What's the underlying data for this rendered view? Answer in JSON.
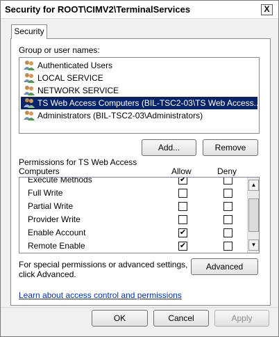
{
  "window": {
    "title": "Security for ROOT\\CIMV2\\TerminalServices",
    "close_label": "X"
  },
  "tabs": [
    {
      "label": "Security"
    }
  ],
  "groups": {
    "label": "Group or user names:",
    "items": [
      {
        "label": "Authenticated Users"
      },
      {
        "label": "LOCAL SERVICE"
      },
      {
        "label": "NETWORK SERVICE"
      },
      {
        "label": "TS Web Access Computers (BIL-TSC2-03\\TS Web Access..."
      },
      {
        "label": "Administrators (BIL-TSC2-03\\Administrators)"
      }
    ],
    "selected_index": 3
  },
  "buttons": {
    "add": "Add...",
    "remove": "Remove",
    "advanced": "Advanced",
    "ok": "OK",
    "cancel": "Cancel",
    "apply": "Apply"
  },
  "permissions": {
    "label_line1": "Permissions for TS Web Access",
    "label_line2": "Computers",
    "allow_header": "Allow",
    "deny_header": "Deny",
    "rows": [
      {
        "name": "Execute Methods",
        "allow": true,
        "deny": false
      },
      {
        "name": "Full Write",
        "allow": false,
        "deny": false
      },
      {
        "name": "Partial Write",
        "allow": false,
        "deny": false
      },
      {
        "name": "Provider Write",
        "allow": false,
        "deny": false
      },
      {
        "name": "Enable Account",
        "allow": true,
        "deny": false
      },
      {
        "name": "Remote Enable",
        "allow": true,
        "deny": false
      }
    ]
  },
  "special_text_line1": "For special permissions or advanced settings,",
  "special_text_line2": "click Advanced.",
  "link_text": "Learn about access control and permissions",
  "icons": {
    "close": "close-icon",
    "user_group": "user-group-icon",
    "checkmark": "✔",
    "scroll_up": "▲",
    "scroll_down": "▼"
  },
  "colors": {
    "selection": "#0a246a",
    "link": "#0033cc"
  }
}
